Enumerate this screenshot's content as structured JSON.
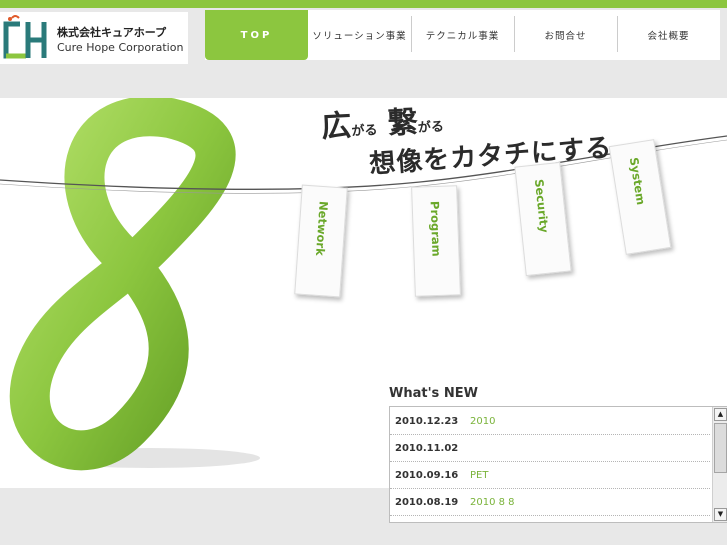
{
  "logo": {
    "name_jp": "株式会社キュアホープ",
    "name_en": "Cure Hope Corporation",
    "icon": "cure-hope-logo-icon"
  },
  "nav": {
    "items": [
      {
        "label": "TOP",
        "active": true
      },
      {
        "label": "ソリューション事業",
        "active": false
      },
      {
        "label": "テクニカル事業",
        "active": false
      },
      {
        "label": "お問合せ",
        "active": false
      },
      {
        "label": "会社概要",
        "active": false
      }
    ]
  },
  "hero": {
    "tagline_word1": "広",
    "tagline_small1": "がる",
    "tagline_word2": "繋",
    "tagline_small2": "がる",
    "tagline_line2": "想像をカタチにする。",
    "tags": [
      "Network",
      "Program",
      "Security",
      "System"
    ]
  },
  "news": {
    "title": "What's NEW",
    "items": [
      {
        "date": "2010.12.23",
        "text": "2010"
      },
      {
        "date": "2010.11.02",
        "text": ""
      },
      {
        "date": "2010.09.16",
        "text": "PET"
      },
      {
        "date": "2010.08.19",
        "text": "2010 8 8"
      }
    ],
    "scroll_up": "▲",
    "scroll_down": "▼"
  },
  "colors": {
    "accent": "#8cc63f",
    "link": "#7ab33a",
    "logo_teal": "#2a7a7a",
    "logo_green": "#8cc63f",
    "background_gray": "#e8e8e8"
  }
}
